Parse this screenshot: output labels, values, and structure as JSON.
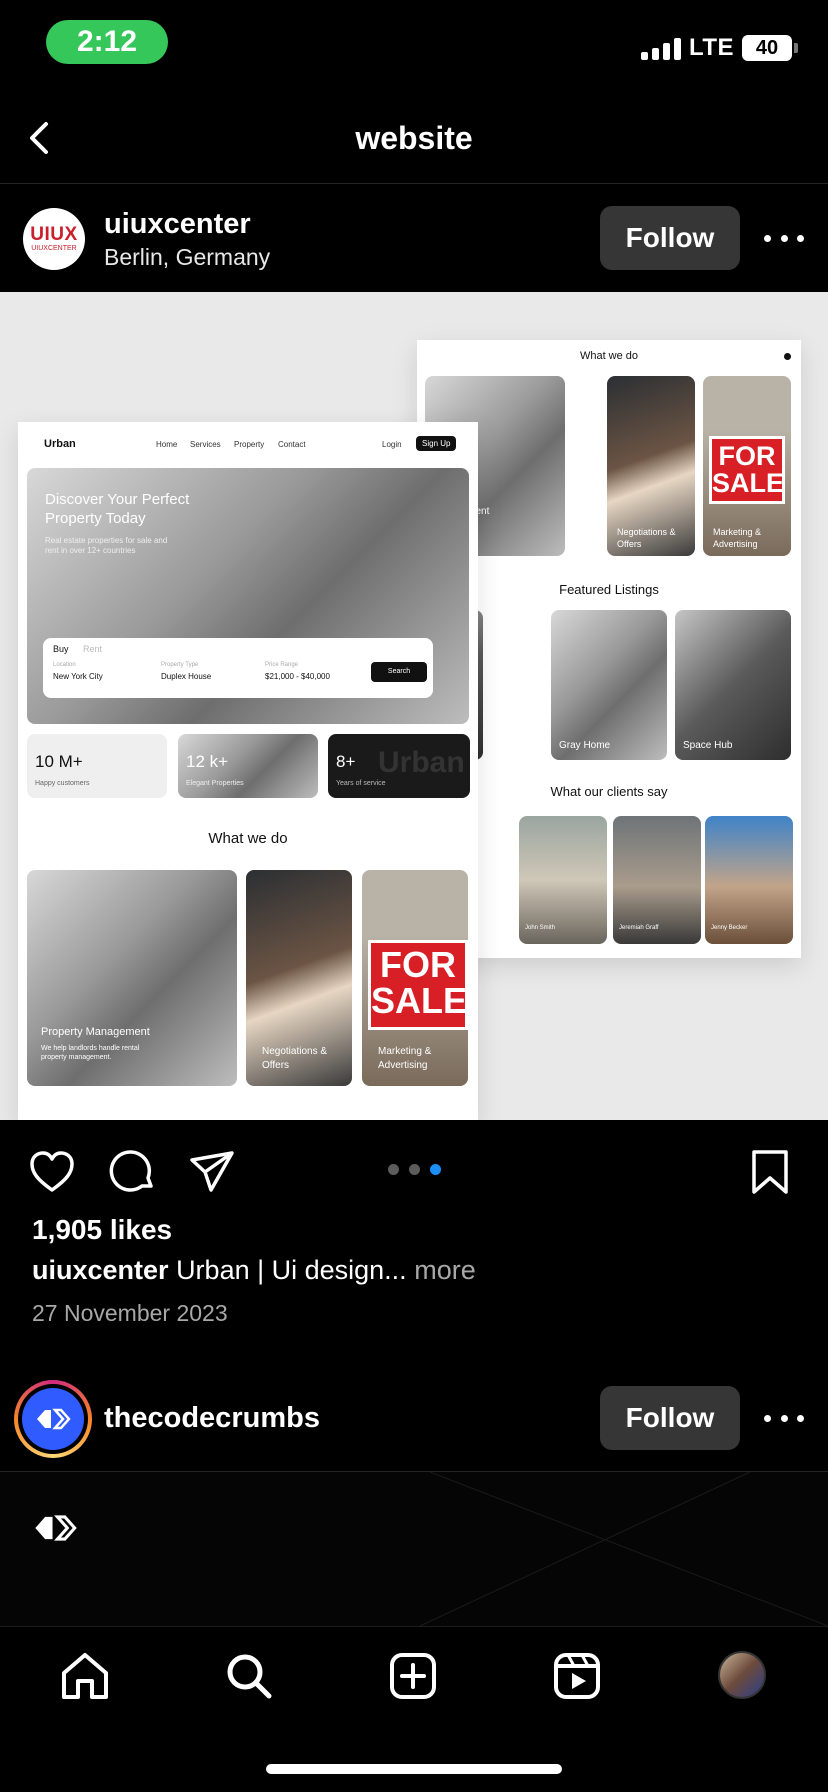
{
  "status_bar": {
    "time": "2:12",
    "network": "LTE",
    "battery": "40"
  },
  "header": {
    "title": "website"
  },
  "post": {
    "username": "uiuxcenter",
    "location": "Berlin, Germany",
    "avatar_logo_text": "UIUX",
    "avatar_logo_sub": "UIUXCENTER",
    "follow_label": "Follow",
    "likes": "1,905 likes",
    "caption_user": "uiuxcenter",
    "caption_text": "Urban | Ui design...",
    "caption_more": "more",
    "date": "27 November 2023",
    "carousel": {
      "count": 3,
      "active_index": 2,
      "active_color": "#1c8ff6"
    },
    "image": {
      "front": {
        "brand": "Urban",
        "nav": [
          "Home",
          "Services",
          "Property",
          "Contact"
        ],
        "login": "Login",
        "signup": "Sign Up",
        "hero_title_1": "Discover Your Perfect",
        "hero_title_2": "Property Today",
        "hero_sub_1": "Real estate properties for sale and",
        "hero_sub_2": "rent in over 12+ countries",
        "tab_buy": "Buy",
        "tab_rent": "Rent",
        "location_label": "Location",
        "location_value": "New York City",
        "type_label": "Property Type",
        "type_value": "Duplex House",
        "price_label": "Price Range",
        "price_value": "$21,000 - $40,000",
        "search": "Search",
        "stat1_value": "10 M+",
        "stat1_label": "Happy customers",
        "stat2_value": "12 k+",
        "stat2_label": "Elegant Properties",
        "stat3_value": "8+",
        "stat3_label": "Years of service",
        "stat3_watermark": "Urban",
        "section_what": "What we do",
        "tile1_title": "Property Management",
        "tile1_sub_1": "We help landlords handle rental",
        "tile1_sub_2": "property management.",
        "tile2_title_1": "Negotiations &",
        "tile2_title_2": "Offers",
        "tile3_title_1": "Marketing &",
        "tile3_title_2": "Advertising",
        "sale_1": "FOR",
        "sale_2": "SALE"
      },
      "back": {
        "section_what": "What we do",
        "tile1_title": "Management",
        "tile2_title_1": "Negotiations &",
        "tile2_title_2": "Offers",
        "tile3_title_1": "Marketing &",
        "tile3_title_2": "Advertising",
        "sale_1": "FOR",
        "sale_2": "SALE",
        "section_featured": "Featured Listings",
        "listing2": "Gray Home",
        "listing3": "Space Hub",
        "section_clients": "What our clients say",
        "client1": "John Smith",
        "client2": "Jeremiah Graff",
        "client3": "Jenny Becker"
      }
    }
  },
  "post2": {
    "username": "thecodecrumbs",
    "follow_label": "Follow",
    "avatar_color": "#2f5bff"
  },
  "tabbar": {
    "items": [
      "home-icon",
      "search-icon",
      "create-icon",
      "reels-icon",
      "profile-avatar"
    ]
  }
}
